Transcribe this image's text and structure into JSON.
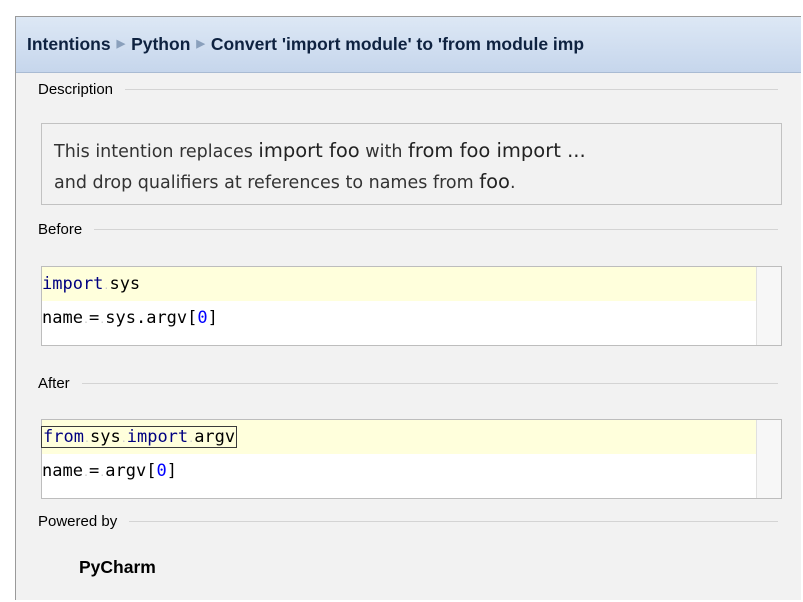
{
  "header": {
    "crumbs": [
      "Intentions",
      "Python",
      "Convert 'import module' to 'from module imp"
    ]
  },
  "sections": {
    "description_label": "Description",
    "before_label": "Before",
    "after_label": "After",
    "powered_label": "Powered by"
  },
  "description": {
    "t1": "This intention replaces ",
    "c1": "import foo",
    "t2": " with ",
    "c2": "from foo import ...",
    "t3": "and drop qualifiers at references to names from ",
    "c3": "foo",
    "t4": "."
  },
  "before": {
    "line1_kw": "import",
    "line1_rest": "sys",
    "line2_a": "name",
    "line2_b": "=",
    "line2_c": "sys.argv[",
    "line2_num": "0",
    "line2_end": "]"
  },
  "after": {
    "line1_kw1": "from",
    "line1_mod": "sys",
    "line1_kw2": "import",
    "line1_name": "argv",
    "line2_a": "name",
    "line2_b": "=",
    "line2_c": "argv[",
    "line2_num": "0",
    "line2_end": "]"
  },
  "powered_by": "PyCharm",
  "colors": {
    "header_bg": "#c6d6ec",
    "highlight_line": "#ffffdc",
    "keyword": "#000080",
    "number": "#0000ff"
  }
}
